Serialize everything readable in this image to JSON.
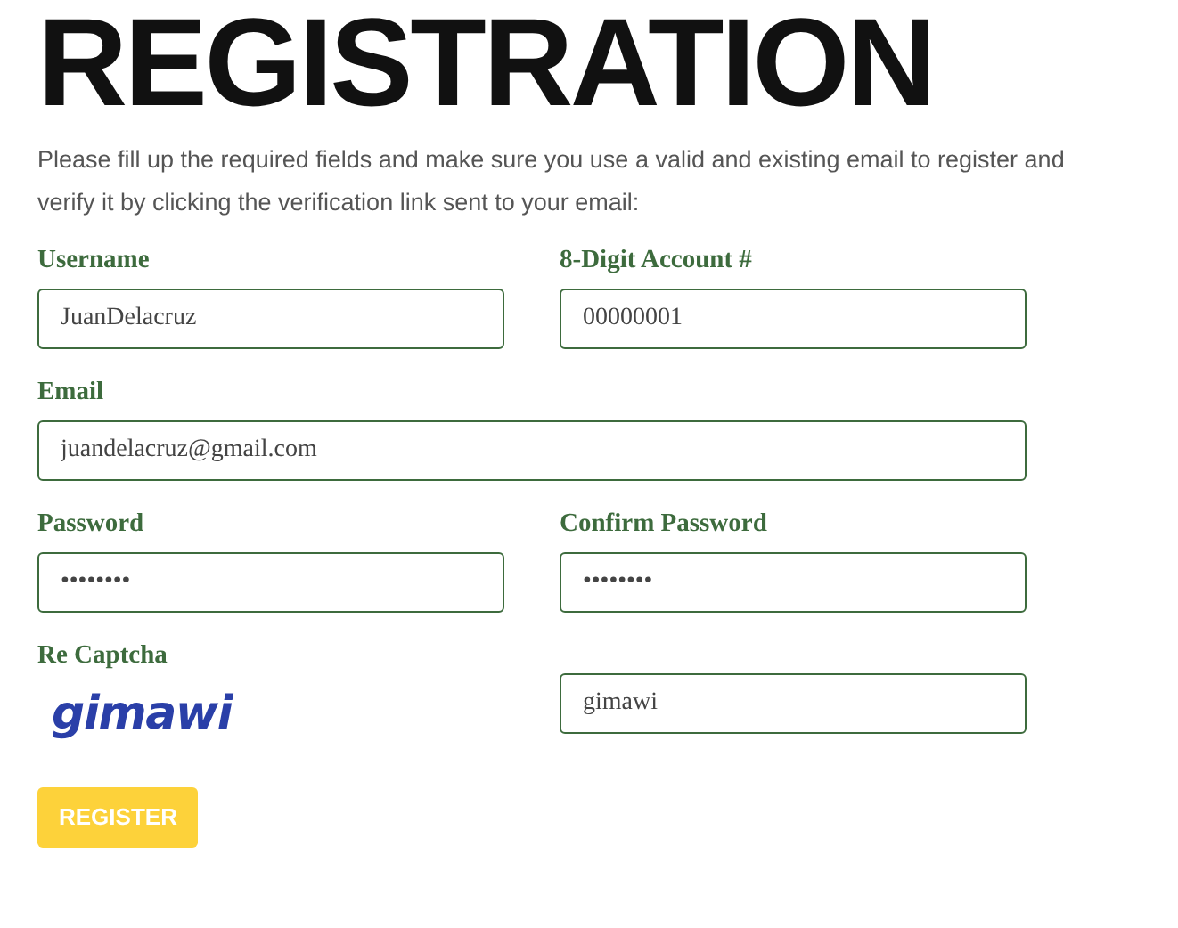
{
  "title": "REGISTRATION",
  "intro": "Please fill up the required fields and make sure you use a valid and existing email to register and verify it by clicking the verification link sent to your email:",
  "rows": [
    [
      {
        "label": "Username",
        "value": "JuanDelacruz"
      },
      {
        "label": "8-Digit Account #",
        "value": "00000001"
      }
    ],
    [
      {
        "label": "Email",
        "value": "juandelacruz@gmail.com"
      }
    ],
    [
      {
        "label": "Password",
        "value": "••••••••"
      },
      {
        "label": "Confirm Password",
        "value": "••••••••"
      }
    ]
  ],
  "captcha": {
    "label": "Re Captcha",
    "image_text": "gimawi",
    "value": "gimawi"
  },
  "submit": "REGISTER"
}
